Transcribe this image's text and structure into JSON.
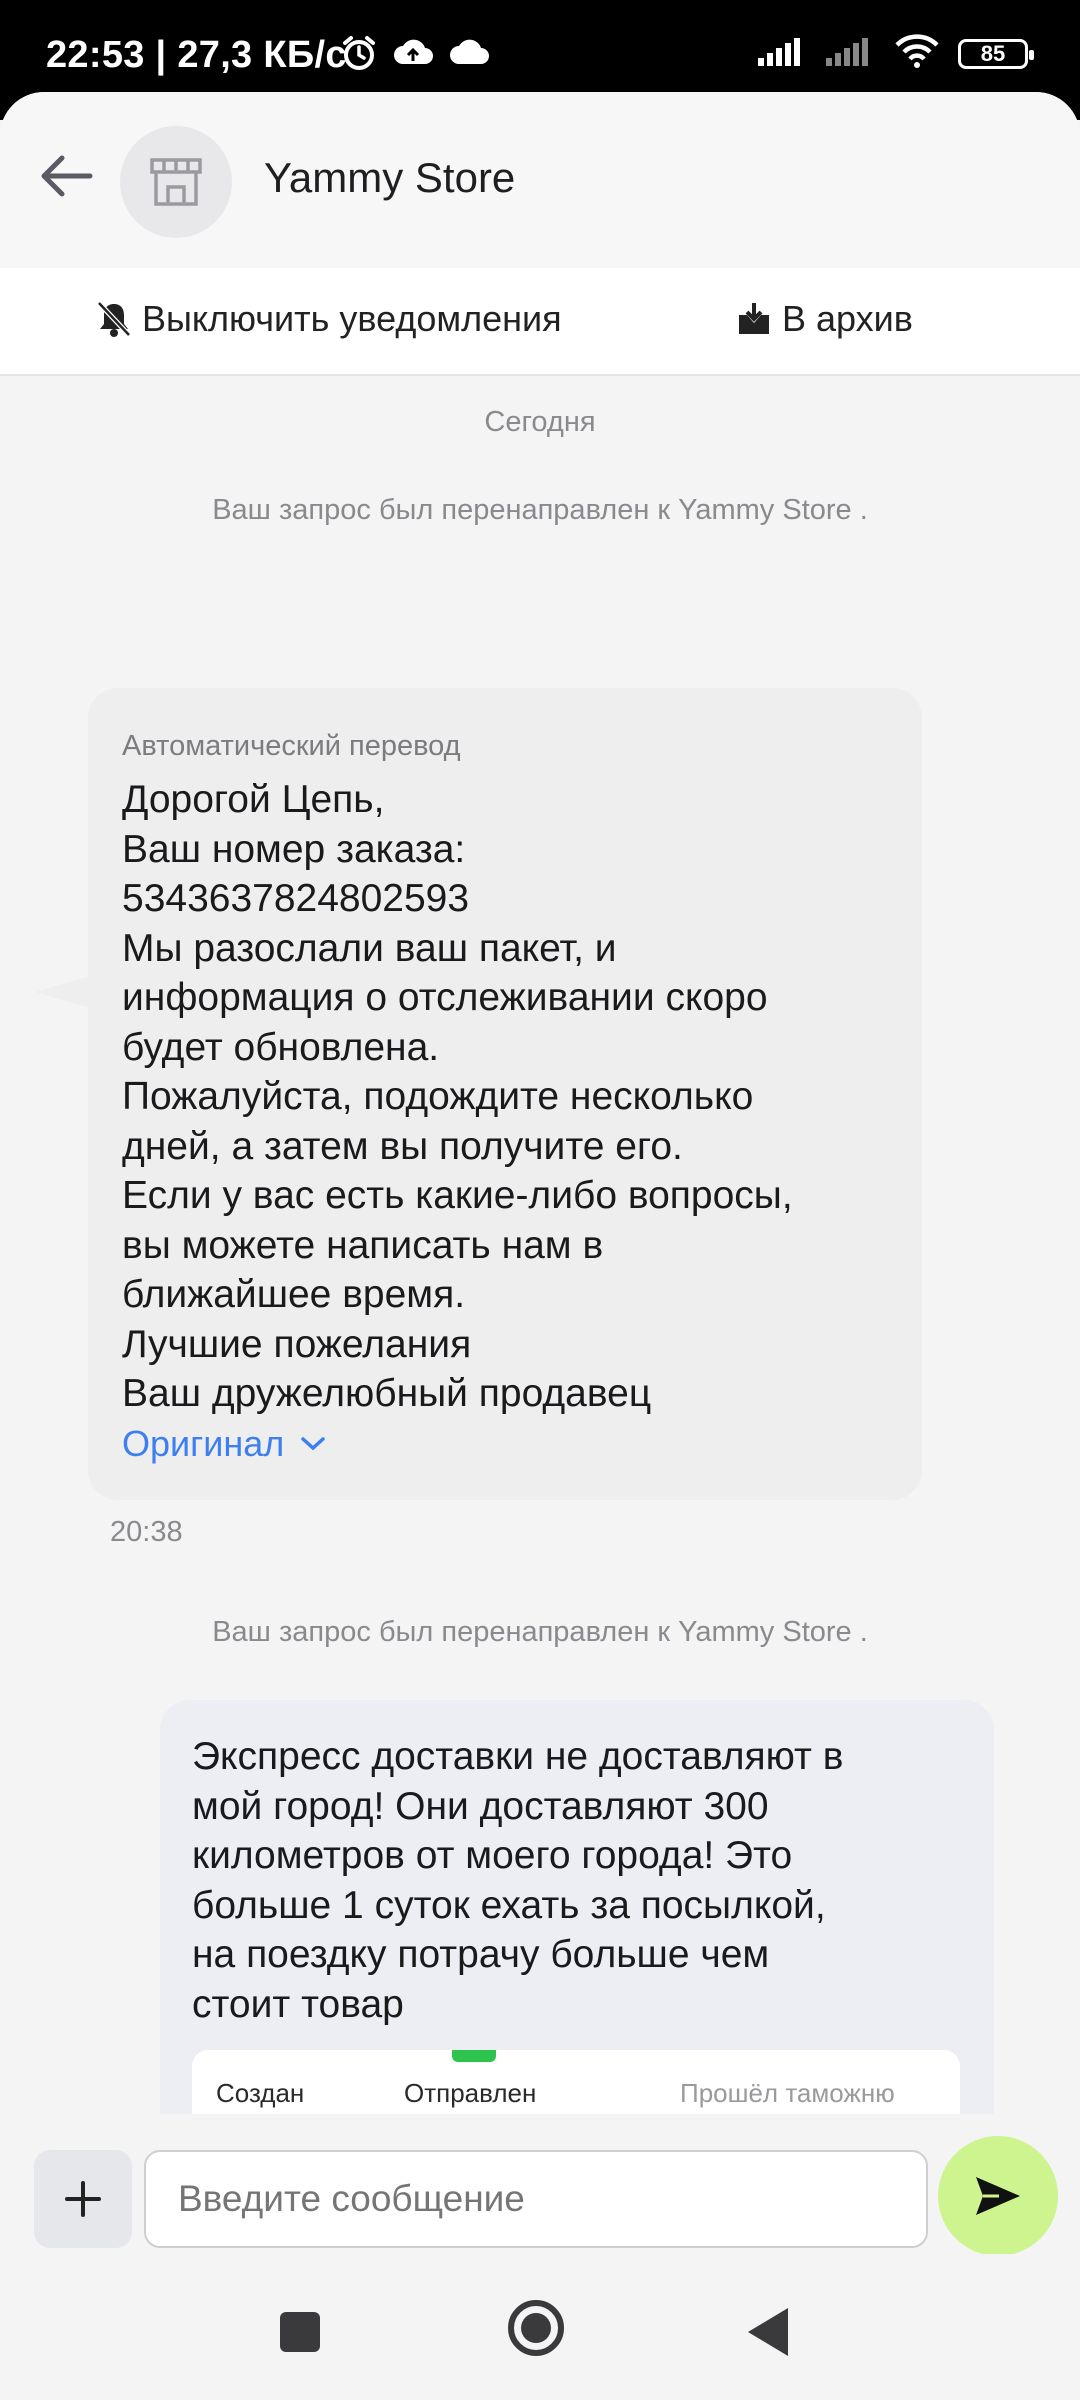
{
  "status_bar": {
    "time": "22:53 | 27,3 КБ/с",
    "battery": "85",
    "icons": [
      "alarm-icon",
      "cloud-upload-icon",
      "cloud-icon",
      "signal-icon",
      "signal-icon",
      "wifi-icon",
      "battery-icon"
    ]
  },
  "header": {
    "title": "Yammy Store",
    "back_icon": "arrow-left-icon",
    "avatar_icon": "storefront-icon"
  },
  "actions": {
    "mute_label": "Выключить уведомления",
    "archive_label": "В архив"
  },
  "chat": {
    "day_label": "Сегодня",
    "system_note_1": "Ваш запрос был перенаправлен к Yammy Store .",
    "incoming": {
      "auto_translation_label": "Автоматический перевод",
      "lines": [
        "Дорогой Цепь,",
        "Ваш номер заказа:",
        "5343637824802593",
        "Мы разослали ваш пакет, и",
        "информация о отслеживании скоро",
        "будет обновлена.",
        "Пожалуйста, подождите несколько",
        "дней, а затем вы получите его.",
        "Если у вас есть какие-либо вопросы,",
        "вы можете написать нам в",
        "ближайшее время.",
        "Лучшие пожелания",
        "Ваш дружелюбный продавец"
      ],
      "original_link": "Оригинал",
      "time": "20:38"
    },
    "system_note_2": "Ваш запрос был перенаправлен к Yammy Store .",
    "outgoing": {
      "lines": [
        "Экспресс доставки не доставляют в",
        "мой город! Они доставляют 300",
        "километров от моего города! Это",
        "больше 1 суток ехать за посылкой,",
        "на поездку потрачу больше чем",
        "стоит товар"
      ],
      "tracking_steps": [
        "Создан",
        "Отправлен",
        "Прошёл таможню"
      ]
    }
  },
  "composer": {
    "placeholder": "Введите сообщение",
    "accent_color": "#cdf48f"
  },
  "colors": {
    "link": "#3d7ff0",
    "incoming_bubble": "#eeeeef",
    "outgoing_bubble": "#eceef3",
    "tracking_green": "#2ec34e"
  }
}
